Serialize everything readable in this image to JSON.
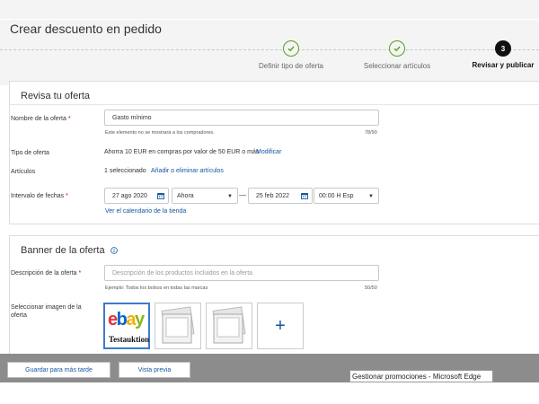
{
  "page": {
    "title": "Crear descuento en pedido"
  },
  "stepper": {
    "steps": [
      {
        "label": "Definir tipo de oferta",
        "state": "done"
      },
      {
        "label": "Seleccionar artículos",
        "state": "done"
      },
      {
        "label": "Revisar y publicar",
        "state": "current",
        "number": "3"
      }
    ],
    "done_color": "#5a9e1c"
  },
  "review": {
    "title": "Revisa tu oferta",
    "offer_name": {
      "label": "Nombre de la oferta",
      "value": "Gasto mínimo",
      "hint": "Este elemento no se mostrará a los compradores.",
      "count": "78/90"
    },
    "offer_type": {
      "label": "Tipo de oferta",
      "value": "Ahorra 10 EUR en compras por valor de 50 EUR o más",
      "action": "Modificar"
    },
    "items": {
      "label": "Artículos",
      "value": "1 seleccionado",
      "action": "Añadir o eliminar artículos"
    },
    "dates": {
      "label": "Intervalo de fechas",
      "start_date": "27 ago 2020",
      "start_time": "Ahora",
      "separator": "—",
      "end_date": "25 feb 2022",
      "end_time": "00:00 H Esp",
      "calendar_link": "Ver el calendario de la tienda"
    }
  },
  "banner": {
    "title": "Banner de la oferta",
    "info_icon": "info-icon",
    "description": {
      "label": "Descripción de la oferta",
      "placeholder": "Descripción de los productos incluidos en la oferta",
      "hint": "Ejemplo: Todos los bolsos en todas las marcas",
      "count": "50/50"
    },
    "image": {
      "label": "Seleccionar imagen de la oferta",
      "selected_logo": "ebay",
      "selected_caption": "Testauktion",
      "add_icon": "plus-icon"
    }
  },
  "footer": {
    "save_later": "Guardar para más tarde",
    "preview": "Vista previa"
  },
  "taskbar": {
    "tooltip": "Gestionar promociones - Microsoft Edge"
  },
  "colors": {
    "link": "#1456a0",
    "selected_border": "#3b7bc8",
    "required": "#cc0000"
  }
}
